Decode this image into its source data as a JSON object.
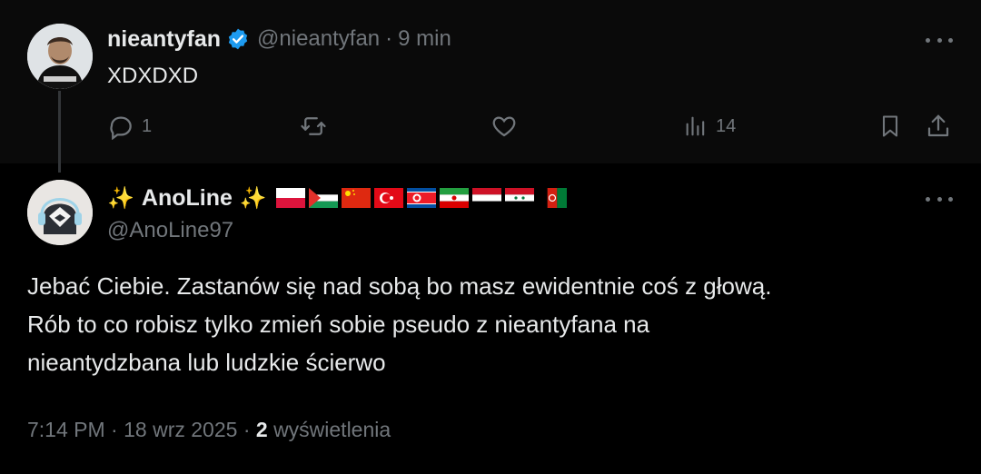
{
  "parent_tweet": {
    "display_name": "nieantyfan",
    "handle": "@nieantyfan",
    "separator": "·",
    "time": "9 min",
    "text": "XDXDXD",
    "reply_count": "1",
    "view_count": "14"
  },
  "reply_tweet": {
    "sparkle": "✨",
    "display_name": "AnoLine",
    "handle": "@AnoLine97",
    "flags": [
      "poland",
      "palestine",
      "china",
      "turkey",
      "north-korea",
      "iran",
      "yemen",
      "syria",
      "afghanistan"
    ],
    "lines": [
      "Jebać Ciebie. Zastanów się nad sobą bo masz ewidentnie coś z głową.",
      "Rób to co robisz tylko zmień sobie pseudo z nieantyfana na",
      "nieantydzbana lub ludzkie ścierwo"
    ],
    "time": "7:14 PM",
    "date": "18 wrz 2025",
    "views": "2",
    "views_label": "wyświetlenia"
  },
  "colors": {
    "background": "#000000",
    "text": "#e7e9ea",
    "secondary": "#71767b",
    "verified": "#1d9bf0"
  }
}
